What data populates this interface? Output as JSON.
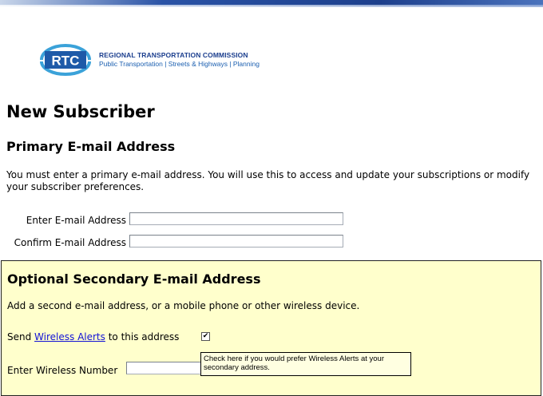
{
  "header": {
    "logo_text": "RTC",
    "org_name": "REGIONAL TRANSPORTATION COMMISSION",
    "org_tagline": "Public Transportation | Streets & Highways | Planning"
  },
  "page": {
    "title": "New Subscriber",
    "primary_heading": "Primary E-mail Address",
    "primary_intro": "You must enter a primary e-mail address. You will use this to access and update your subscriptions or modify your subscriber preferences."
  },
  "primary_form": {
    "email_label": "Enter E-mail Address",
    "email_value": "",
    "confirm_label": "Confirm E-mail Address",
    "confirm_value": ""
  },
  "secondary": {
    "heading": "Optional Secondary E-mail Address",
    "description": "Add a second e-mail address, or a mobile phone or other wireless device.",
    "send_prefix": "Send ",
    "wireless_link": "Wireless Alerts",
    "send_suffix": " to this address",
    "checkbox_checked": true,
    "checkbox_glyph": "✔",
    "tooltip": "Check here if you would prefer Wireless Alerts at your secondary address.",
    "wireless_label": "Enter Wireless Number",
    "wireless_value": ""
  },
  "colors": {
    "brand_blue": "#1b3e8e",
    "panel_bg": "#ffffcc",
    "link": "#1212d6"
  }
}
